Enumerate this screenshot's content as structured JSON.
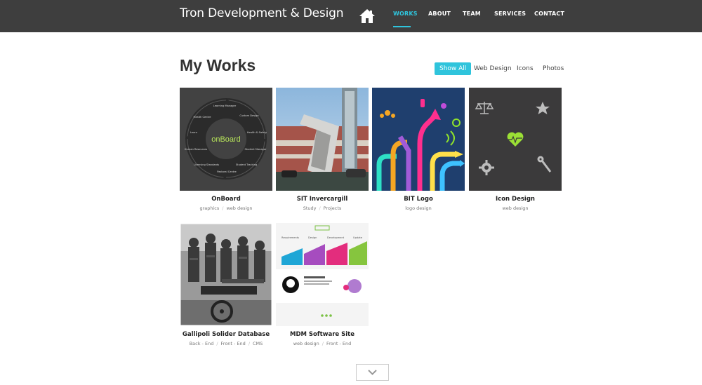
{
  "header": {
    "brand": "Tron Development & Design",
    "nav": [
      {
        "label": "WORKS",
        "active": true
      },
      {
        "label": "ABOUT",
        "active": false
      },
      {
        "label": "TEAM",
        "active": false
      },
      {
        "label": "SERVICES",
        "active": false
      },
      {
        "label": "CONTACT",
        "active": false
      }
    ],
    "home_icon": "house-icon"
  },
  "works": {
    "title": "My Works",
    "filters": [
      {
        "label": "Show All",
        "active": true
      },
      {
        "label": "Web Design",
        "active": false
      },
      {
        "label": "Icons",
        "active": false
      },
      {
        "label": "Photos",
        "active": false
      }
    ],
    "items": [
      {
        "title": "OnBoard",
        "tags": [
          "graphics",
          "web design"
        ]
      },
      {
        "title": "SIT Invercargill",
        "tags": [
          "Study",
          "Projects"
        ]
      },
      {
        "title": "BIT Logo",
        "tags": [
          "logo design"
        ]
      },
      {
        "title": "Icon Design",
        "tags": [
          "web design"
        ]
      },
      {
        "title": "Gallipoli Solider Database",
        "tags": [
          "Back - End",
          "Front - End",
          "CMS"
        ]
      },
      {
        "title": "MDM Software Site",
        "tags": [
          "web design",
          "Front - End"
        ]
      }
    ],
    "onboard_logo": "onBoard",
    "onboard_labels": [
      "Learning Manager",
      "Custom Design",
      "Health & Safety",
      "Student Manager",
      "Student Tracking",
      "Pastoral Centre",
      "Licensing Standards",
      "Human Resources",
      "Learn",
      "Health Centre"
    ],
    "mdm_columns": [
      "Requirements",
      "Design",
      "Development",
      "Update"
    ],
    "more_icon": "chevron-down-icon"
  },
  "colors": {
    "header_bg": "#3e3e3e",
    "accent": "#2fc4dc",
    "icon_tile_bg": "#3b3a3b",
    "bit_bg": "#1f3f6e"
  }
}
